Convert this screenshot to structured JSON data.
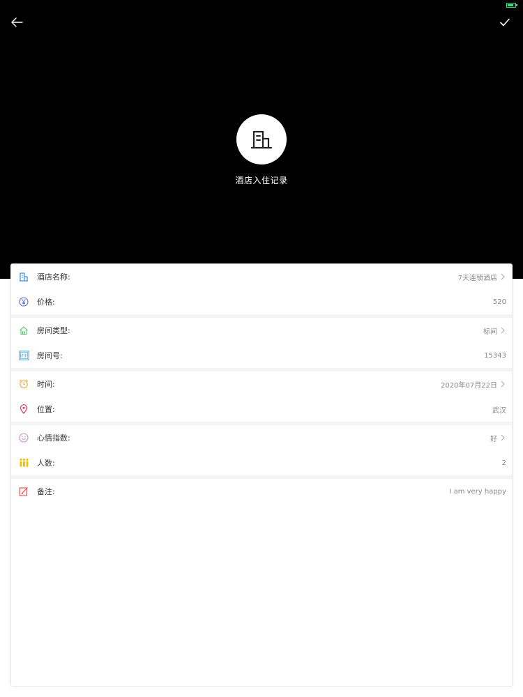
{
  "header": {
    "title": "酒店入住记录",
    "back_icon": "arrow-left-icon",
    "confirm_icon": "checkmark-icon",
    "avatar_icon": "building-icon",
    "background_color": "#000000"
  },
  "form": {
    "groups": [
      {
        "rows": [
          {
            "label": "酒店名称:",
            "value": "7天连锁酒店",
            "icon": "hotel-icon",
            "icon_color": "#3a8ee6",
            "has_chevron": true
          },
          {
            "label": "价格:",
            "value": "520",
            "icon": "yen-icon",
            "icon_color": "#5b6bd6",
            "has_chevron": false
          }
        ]
      },
      {
        "rows": [
          {
            "label": "房间类型:",
            "value": "标间",
            "icon": "home-icon",
            "icon_color": "#4cc46a",
            "has_chevron": true
          },
          {
            "label": "房间号:",
            "value": "15343",
            "icon": "room-number-icon",
            "icon_color": "#3fb6e8",
            "has_chevron": false
          }
        ]
      },
      {
        "rows": [
          {
            "label": "时间:",
            "value": "2020年07月22日",
            "icon": "alarm-clock-icon",
            "icon_color": "#f0a93b",
            "has_chevron": true
          },
          {
            "label": "位置:",
            "value": "武汉",
            "icon": "location-pin-icon",
            "icon_color": "#e0375a",
            "has_chevron": false
          }
        ]
      },
      {
        "rows": [
          {
            "label": "心情指数:",
            "value": "好",
            "icon": "smiley-icon",
            "icon_color": "#c98ad8",
            "has_chevron": true
          },
          {
            "label": "人数:",
            "value": "2",
            "icon": "people-icon",
            "icon_color": "#f5c400",
            "has_chevron": false
          }
        ]
      },
      {
        "rows": [
          {
            "label": "备注:",
            "value": "I am very happy",
            "icon": "note-edit-icon",
            "icon_color": "#e84848",
            "has_chevron": false
          }
        ]
      }
    ]
  }
}
